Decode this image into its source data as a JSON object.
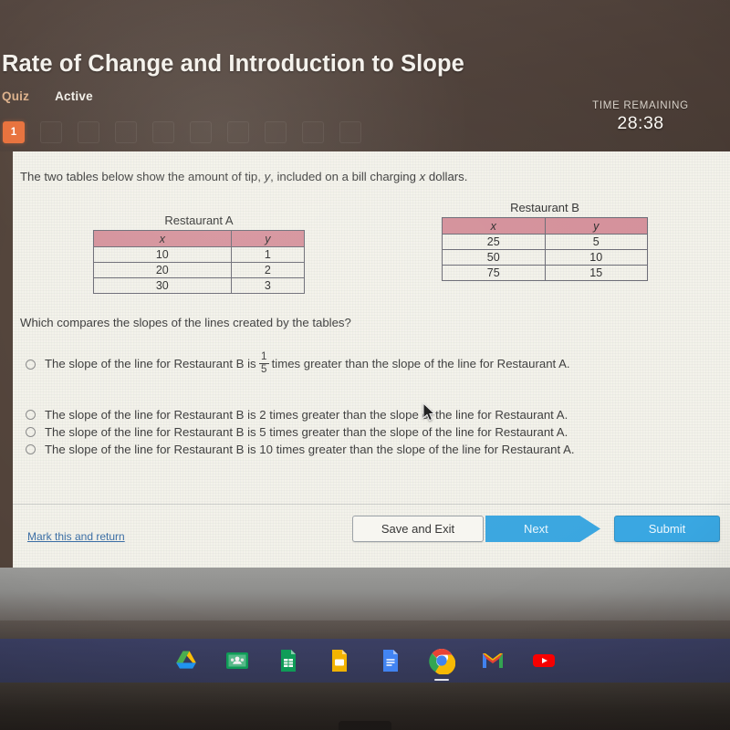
{
  "header": {
    "title": "Rate of Change and Introduction to Slope",
    "quiz_label": "Quiz",
    "status_label": "Active",
    "timer_label": "TIME REMAINING",
    "timer_value": "28:38",
    "accent_color": "#e8703a",
    "bar_color": "#4c3e37"
  },
  "question_nav": {
    "items": [
      {
        "label": "1",
        "active": true
      },
      {
        "label": "",
        "active": false
      },
      {
        "label": "",
        "active": false
      },
      {
        "label": "",
        "active": false
      },
      {
        "label": "",
        "active": false
      },
      {
        "label": "",
        "active": false
      },
      {
        "label": "",
        "active": false
      },
      {
        "label": "",
        "active": false
      },
      {
        "label": "",
        "active": false
      },
      {
        "label": "",
        "active": false
      }
    ]
  },
  "content": {
    "prompt_part1": "The two tables below show the amount of tip, ",
    "prompt_var_y": "y",
    "prompt_part2": ", included on a bill charging ",
    "prompt_var_x": "x",
    "prompt_part3": " dollars.",
    "question": "Which compares the slopes of the lines created by the tables?",
    "tables": [
      {
        "caption": "Restaurant A",
        "headers": [
          "x",
          "y"
        ],
        "rows": [
          [
            "10",
            "1"
          ],
          [
            "20",
            "2"
          ],
          [
            "30",
            "3"
          ]
        ]
      },
      {
        "caption": "Restaurant B",
        "headers": [
          "x",
          "y"
        ],
        "rows": [
          [
            "25",
            "5"
          ],
          [
            "50",
            "10"
          ],
          [
            "75",
            "15"
          ]
        ]
      }
    ],
    "header_color": "#d4909a",
    "options": [
      {
        "prefix": "The slope of the line for Restaurant B is",
        "fraction_num": "1",
        "fraction_den": "5",
        "suffix": "times greater than the slope of the line for Restaurant A.",
        "selected": false
      },
      {
        "text": "The slope of the line for Restaurant B is 2 times greater than the slope of the line for Restaurant A.",
        "selected": false
      },
      {
        "text": "The slope of the line for Restaurant B is 5 times greater than the slope of the line for Restaurant A.",
        "selected": false
      },
      {
        "text": "The slope of the line for Restaurant B is 10 times greater than the slope of the line for Restaurant A.",
        "selected": false
      }
    ]
  },
  "footer": {
    "mark_link": "Mark this and return",
    "save_label": "Save and Exit",
    "next_label": "Next",
    "submit_label": "Submit",
    "button_color": "#39a7e2"
  },
  "taskbar": {
    "icons": [
      {
        "name": "google-drive-icon",
        "active": false
      },
      {
        "name": "google-classroom-icon",
        "active": false
      },
      {
        "name": "google-sheets-icon",
        "active": false
      },
      {
        "name": "google-slides-icon",
        "active": false
      },
      {
        "name": "google-docs-icon",
        "active": false
      },
      {
        "name": "google-chrome-icon",
        "active": true
      },
      {
        "name": "gmail-icon",
        "active": false
      },
      {
        "name": "youtube-icon",
        "active": false
      }
    ]
  }
}
